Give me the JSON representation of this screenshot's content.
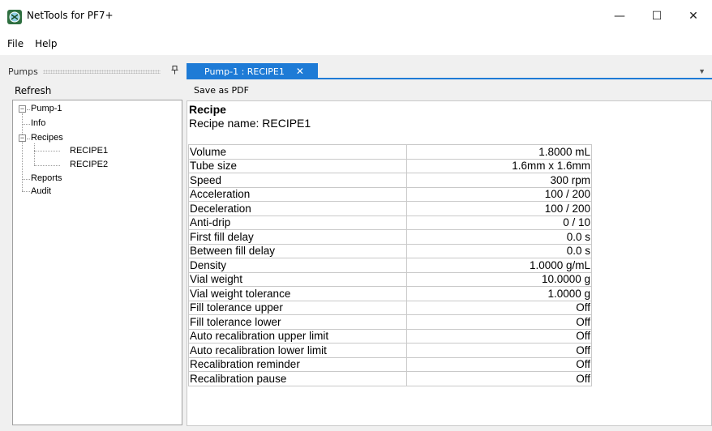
{
  "window": {
    "title": "NetTools for PF7+",
    "icon": "nettools-app-icon",
    "controls": {
      "minimize": "—",
      "maximize": "☐",
      "close": "✕"
    }
  },
  "menu": {
    "items": [
      "File",
      "Help"
    ]
  },
  "pumps_panel": {
    "title": "Pumps",
    "pin_icon": "pin-icon",
    "refresh_label": "Refresh",
    "tree": {
      "root": "Pump-1",
      "children": [
        "Info",
        "Recipes",
        "Reports",
        "Audit"
      ],
      "recipes": [
        "RECIPE1",
        "RECIPE2"
      ]
    }
  },
  "tabs": {
    "active": "Pump-1 : RECIPE1",
    "close_glyph": "✕",
    "dropdown_glyph": "▼"
  },
  "toolbar": {
    "save_pdf_label": "Save as PDF"
  },
  "recipe": {
    "heading": "Recipe",
    "name_line": "Recipe name: RECIPE1",
    "rows": [
      [
        "Volume",
        "1.8000 mL"
      ],
      [
        "Tube size",
        "1.6mm x 1.6mm"
      ],
      [
        "Speed",
        "300 rpm"
      ],
      [
        "Acceleration",
        "100 / 200"
      ],
      [
        "Deceleration",
        "100 / 200"
      ],
      [
        "Anti-drip",
        "0 / 10"
      ],
      [
        "First fill delay",
        "0.0 s"
      ],
      [
        "Between fill delay",
        "0.0 s"
      ],
      [
        "Density",
        "1.0000 g/mL"
      ],
      [
        "Vial weight",
        "10.0000 g"
      ],
      [
        "Vial weight tolerance",
        "1.0000 g"
      ],
      [
        "Fill tolerance upper",
        "Off"
      ],
      [
        "Fill tolerance lower",
        "Off"
      ],
      [
        "Auto recalibration upper limit",
        "Off"
      ],
      [
        "Auto recalibration lower limit",
        "Off"
      ],
      [
        "Recalibration reminder",
        "Off"
      ],
      [
        "Recalibration pause",
        "Off"
      ]
    ]
  },
  "colors": {
    "accent": "#1e7bd6",
    "window_bg": "#f0f0f0",
    "panel_bg": "#ffffff",
    "grid_line": "#c9c9c9"
  }
}
